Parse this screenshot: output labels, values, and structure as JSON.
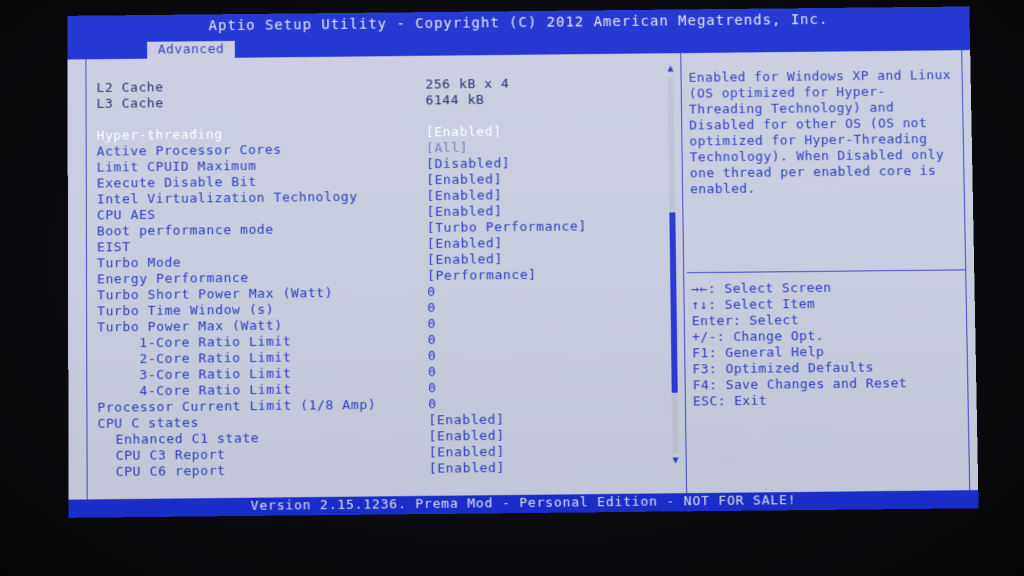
{
  "window": {
    "title": "Aptio Setup Utility - Copyright (C) 2012 American Megatrends, Inc.",
    "active_tab": "Advanced"
  },
  "settings": [
    {
      "label": "L2 Cache",
      "value": "256 kB x 4",
      "type": "info"
    },
    {
      "label": "L3 Cache",
      "value": "6144 kB",
      "type": "info"
    },
    {
      "label": "Hyper-threading",
      "value": "[Enabled]",
      "type": "selected"
    },
    {
      "label": "Active Processor Cores",
      "value": "[All]",
      "type": "disabled"
    },
    {
      "label": "Limit CPUID Maximum",
      "value": "[Disabled]",
      "type": "option"
    },
    {
      "label": "Execute Disable Bit",
      "value": "[Enabled]",
      "type": "option"
    },
    {
      "label": "Intel Virtualization Technology",
      "value": "[Enabled]",
      "type": "option"
    },
    {
      "label": "CPU AES",
      "value": "[Enabled]",
      "type": "option"
    },
    {
      "label": "Boot performance mode",
      "value": "[Turbo Performance]",
      "type": "option"
    },
    {
      "label": "EIST",
      "value": "[Enabled]",
      "type": "option"
    },
    {
      "label": "Turbo Mode",
      "value": "[Enabled]",
      "type": "option"
    },
    {
      "label": "Energy Performance",
      "value": "[Performance]",
      "type": "option"
    },
    {
      "label": "Turbo Short Power Max (Watt)",
      "value": "0",
      "type": "option"
    },
    {
      "label": "Turbo Time Window (s)",
      "value": "0",
      "type": "option"
    },
    {
      "label": "Turbo Power Max (Watt)",
      "value": "0",
      "type": "option"
    },
    {
      "label": "1-Core Ratio Limit",
      "value": "0",
      "type": "option"
    },
    {
      "label": "2-Core Ratio Limit",
      "value": "0",
      "type": "option"
    },
    {
      "label": "3-Core Ratio Limit",
      "value": "0",
      "type": "option"
    },
    {
      "label": "4-Core Ratio Limit",
      "value": "0",
      "type": "option"
    },
    {
      "label": "Processor Current Limit (1/8 Amp)",
      "value": "0",
      "type": "option"
    },
    {
      "label": "CPU C states",
      "value": "[Enabled]",
      "type": "option"
    },
    {
      "label": "Enhanced C1 state",
      "value": "[Enabled]",
      "type": "option"
    },
    {
      "label": "CPU C3 Report",
      "value": "[Enabled]",
      "type": "option"
    },
    {
      "label": "CPU C6 report",
      "value": "[Enabled]",
      "type": "option"
    }
  ],
  "help": {
    "description": "Enabled for Windows XP and Linux (OS optimized for Hyper-Threading Technology) and Disabled for other OS (OS not optimized for Hyper-Threading Technology). When Disabled only one thread per enabled core is enabled."
  },
  "keys": [
    "→←: Select Screen",
    "↑↓: Select Item",
    "Enter: Select",
    "+/-: Change Opt.",
    "F1: General Help",
    "F3: Optimized Defaults",
    "F4: Save Changes and Reset",
    "ESC: Exit"
  ],
  "footer": {
    "version": "Version 2.15.1236. Prema Mod - Personal Edition - NOT FOR SALE!"
  },
  "colors": {
    "bar": "#1c2fd0",
    "panel": "#c9cde0",
    "text": "#2b3bbf",
    "selected": "#ffffff"
  },
  "icons": {
    "scroll_up": "triangle-up-icon",
    "scroll_down": "triangle-down-icon"
  }
}
